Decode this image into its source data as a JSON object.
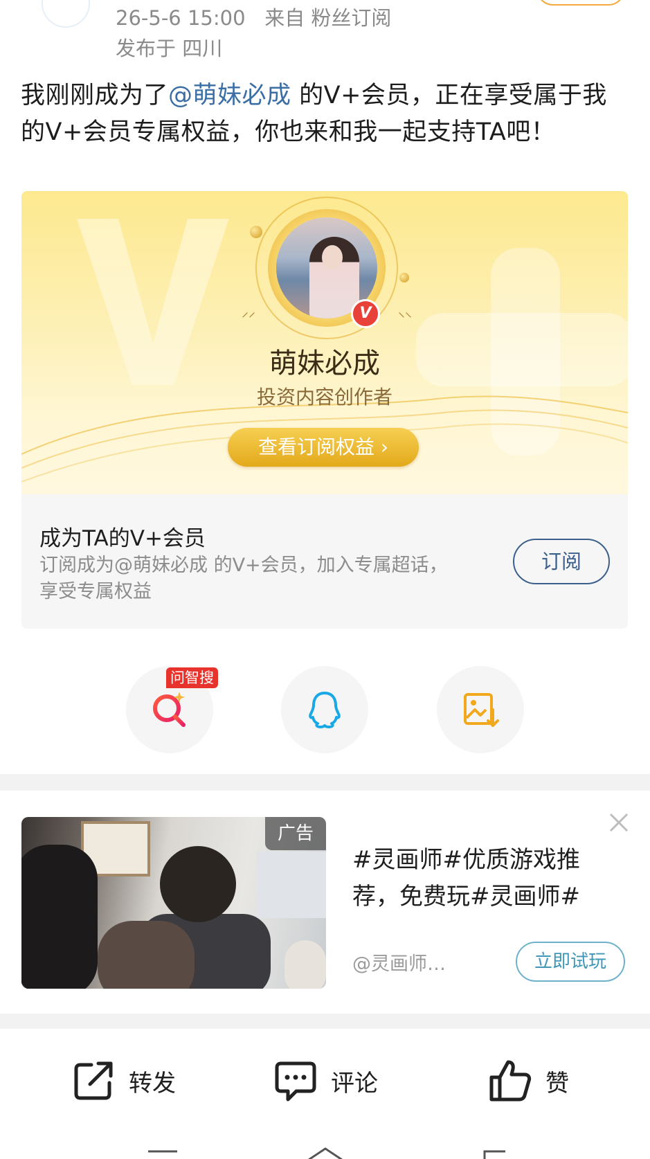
{
  "post": {
    "timestamp": "26-5-6 15:00",
    "source": "来自 粉丝订阅",
    "location": "发布于 四川",
    "text_before": "我刚刚成为了",
    "mention": "@萌妹必成",
    "text_after": " 的V+会员，正在享受属于我的V+会员专属权益，你也来和我一起支持TA吧！"
  },
  "vcard": {
    "creator_name": "萌妹必成",
    "creator_role": "投资内容创作者",
    "benefit_button": "查看订阅权益 ›",
    "badge_letter": "V"
  },
  "subscribe": {
    "title": "成为TA的V+会员",
    "description": "订阅成为@萌妹必成 的V+会员，加入专属超话，享受专属权益",
    "button": "订阅"
  },
  "share": {
    "zhisou_badge": "问智搜",
    "icons": [
      "zhisou-search-icon",
      "qq-icon",
      "save-image-icon"
    ]
  },
  "ad": {
    "tag": "广告",
    "title": "#灵画师#优质游戏推荐，免费玩#灵画师#",
    "source": "@灵画师…",
    "button": "立即试玩"
  },
  "actions": {
    "repost": "转发",
    "comment": "评论",
    "like": "赞"
  },
  "colors": {
    "mention": "#3a6ea5",
    "gold": "#e3a91b",
    "subscribe_border": "#3c5f8c",
    "ad_button": "#3f96b6",
    "badge_red": "#e8322c"
  }
}
